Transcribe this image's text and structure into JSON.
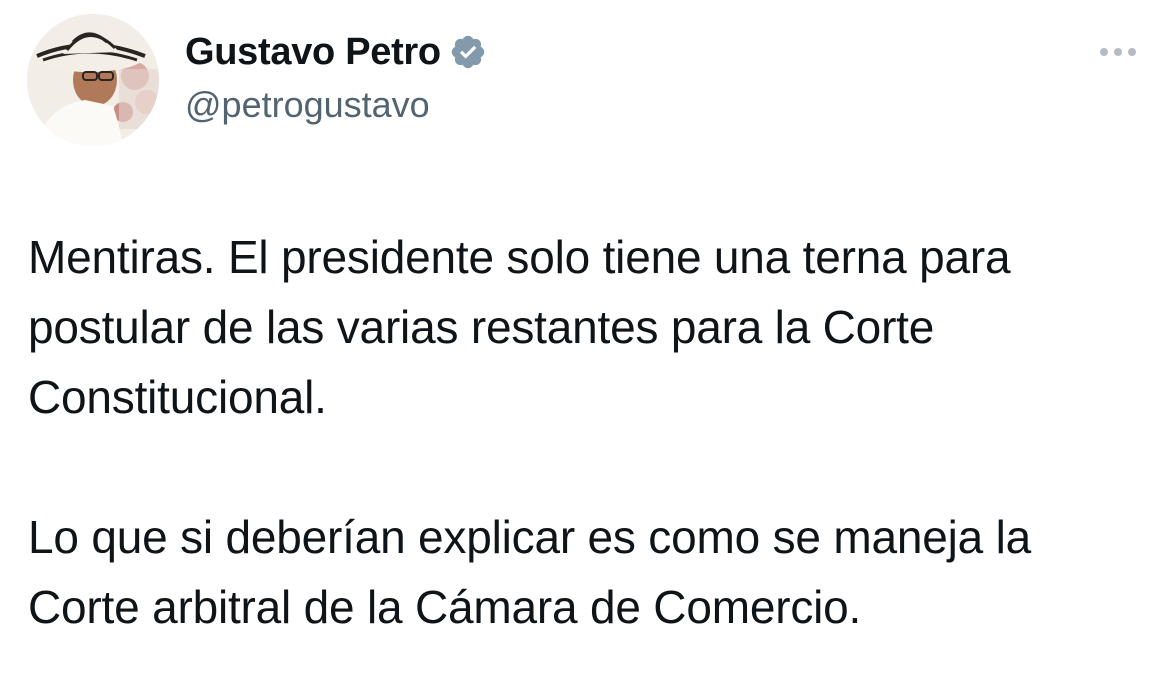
{
  "author": {
    "display_name": "Gustavo Petro",
    "handle": "@petrogustavo",
    "verified_icon": "verified-badge-icon",
    "avatar_icon": "profile-photo"
  },
  "menu": {
    "icon": "more-options-icon"
  },
  "tweet": {
    "paragraphs": [
      "Mentiras. El presidente solo tiene una terna para postular de las varias restantes para la Corte Constitucional.",
      "Lo que si deberían explicar es como se maneja la Corte arbitral de la Cámara de Comercio."
    ]
  },
  "colors": {
    "text": "#0f1419",
    "handle": "#536471",
    "verified": "#829aab",
    "menu_dots": "#b4bcc3"
  }
}
